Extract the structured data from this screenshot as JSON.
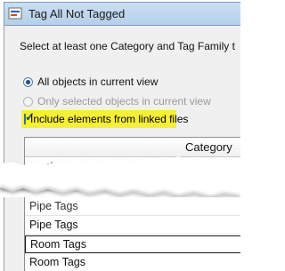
{
  "window": {
    "title": "Tag All Not Tagged"
  },
  "dialog": {
    "instruction": "Select at least one Category and Tag Family t",
    "options": {
      "all_objects": "All objects in current view",
      "selected_objects": "Only selected objects in current view"
    },
    "include_linked_label": "Include elements from linked files",
    "include_linked_checked": true,
    "highlight_color": "#f6ef3a"
  },
  "category_list": {
    "header": "Category",
    "first_row_partial": "Mechanical Equipment Tags",
    "rows": [
      "Pipe Tags",
      "Pipe Tags",
      "Room Tags",
      "Room Tags"
    ]
  }
}
